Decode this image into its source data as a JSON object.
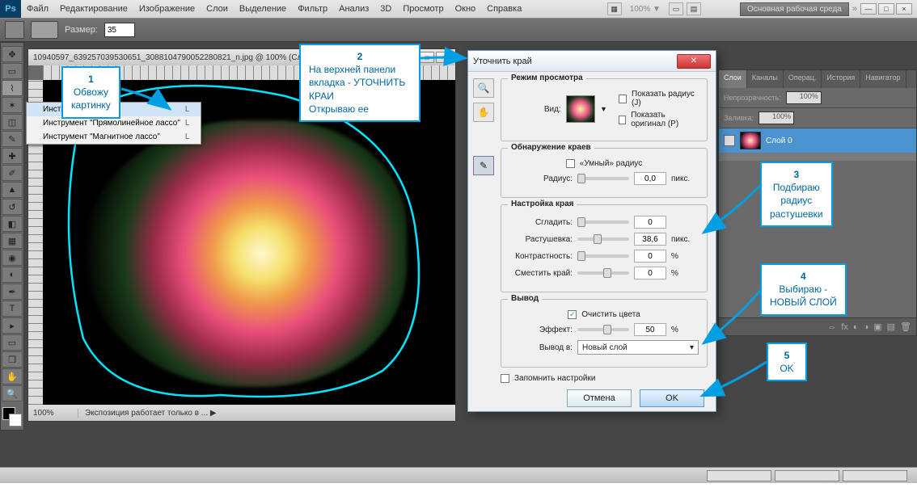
{
  "menubar": {
    "items": [
      "Файл",
      "Редактирование",
      "Изображение",
      "Слои",
      "Выделение",
      "Фильтр",
      "Анализ",
      "3D",
      "Просмотр",
      "Окно",
      "Справка"
    ],
    "zoom": "100% ▼",
    "workspace": "Основная рабочая среда",
    "chevrons": "»"
  },
  "optbar": {
    "size_label": "Размер:",
    "size_value": "35"
  },
  "lasso_menu": {
    "items": [
      {
        "label": "Инструмент \"Лассо\"",
        "hot": "L"
      },
      {
        "label": "Инструмент \"Прямолинейное лассо\"",
        "hot": "L"
      },
      {
        "label": "Инструмент \"Магнитное лассо\"",
        "hot": "L"
      }
    ]
  },
  "document": {
    "title": "10940597_639257039530651_3088104790052280821_n.jpg @ 100% (Сло...",
    "zoom": "100%",
    "status": "Экспозиция работает только в ...   ▶"
  },
  "dialog": {
    "title": "Уточнить край",
    "view_mode_title": "Режим просмотра",
    "view_label": "Вид:",
    "show_radius": "Показать радиус (J)",
    "show_original": "Показать оригинал (P)",
    "edge_detection_title": "Обнаружение краев",
    "smart_radius": "«Умный» радиус",
    "radius_label": "Радиус:",
    "radius_value": "0,0",
    "radius_unit": "пикс.",
    "adjust_edge_title": "Настройка края",
    "smooth_label": "Сгладить:",
    "smooth_value": "0",
    "feather_label": "Растушевка:",
    "feather_value": "38,6",
    "feather_unit": "пикс.",
    "contrast_label": "Контрастность:",
    "contrast_value": "0",
    "contrast_unit": "%",
    "shift_label": "Сместить край:",
    "shift_value": "0",
    "shift_unit": "%",
    "output_title": "Вывод",
    "decontaminate": "Очистить цвета",
    "amount_label": "Эффект:",
    "amount_value": "50",
    "amount_unit": "%",
    "output_to_label": "Вывод в:",
    "output_to_value": "Новый слой",
    "remember": "Запомнить настройки",
    "cancel": "Отмена",
    "ok": "OK"
  },
  "panels": {
    "tabs": [
      "Слои",
      "Каналы",
      "Операц.",
      "История",
      "Навигатор"
    ],
    "opacity_label": "Непрозрачность:",
    "opacity_value": "100%",
    "fill_label": "Заливка:",
    "fill_value": "100%",
    "layer_name": "Слой 0",
    "locks_label": "—"
  },
  "callouts": {
    "c1_num": "1",
    "c1_text": "Обвожу\nкартинку",
    "c2_num": "2",
    "c2_text": "На верхней панели\nвкладка - УТОЧНИТЬ\nКРАИ\nОткрываю ее",
    "c3_num": "3",
    "c3_text": "Подбираю\nрадиус\nрастушевки",
    "c4_num": "4",
    "c4_text": "Выбираю -\nНОВЫЙ СЛОЙ",
    "c5_num": "5",
    "c5_text": "OK"
  },
  "win_controls": {
    "min": "—",
    "max": "□",
    "close": "×"
  }
}
